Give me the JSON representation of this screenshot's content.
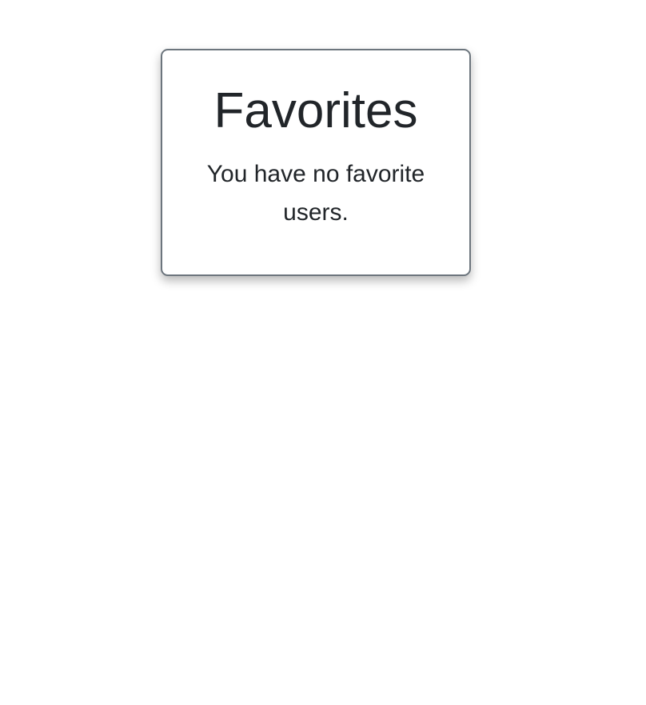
{
  "favorites": {
    "title": "Favorites",
    "empty_message": "You have no favorite users."
  }
}
